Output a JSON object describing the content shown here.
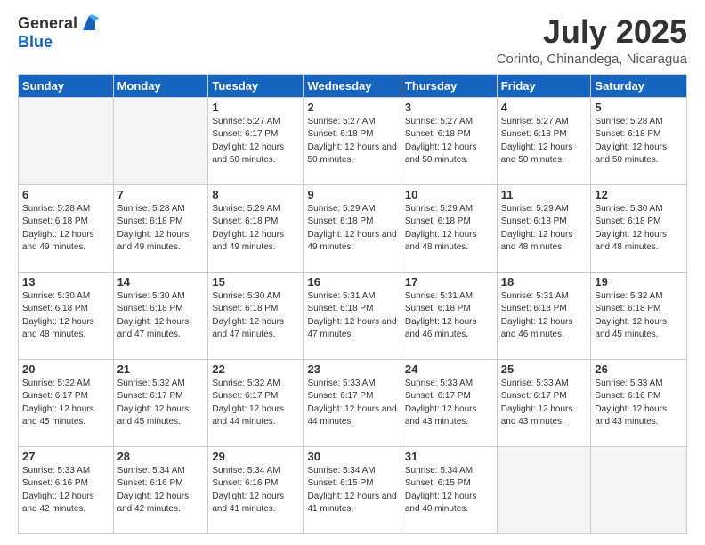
{
  "header": {
    "logo_general": "General",
    "logo_blue": "Blue",
    "month_title": "July 2025",
    "location": "Corinto, Chinandega, Nicaragua"
  },
  "days_of_week": [
    "Sunday",
    "Monday",
    "Tuesday",
    "Wednesday",
    "Thursday",
    "Friday",
    "Saturday"
  ],
  "weeks": [
    [
      {
        "day": "",
        "info": ""
      },
      {
        "day": "",
        "info": ""
      },
      {
        "day": "1",
        "info": "Sunrise: 5:27 AM\nSunset: 6:17 PM\nDaylight: 12 hours and 50 minutes."
      },
      {
        "day": "2",
        "info": "Sunrise: 5:27 AM\nSunset: 6:18 PM\nDaylight: 12 hours and 50 minutes."
      },
      {
        "day": "3",
        "info": "Sunrise: 5:27 AM\nSunset: 6:18 PM\nDaylight: 12 hours and 50 minutes."
      },
      {
        "day": "4",
        "info": "Sunrise: 5:27 AM\nSunset: 6:18 PM\nDaylight: 12 hours and 50 minutes."
      },
      {
        "day": "5",
        "info": "Sunrise: 5:28 AM\nSunset: 6:18 PM\nDaylight: 12 hours and 50 minutes."
      }
    ],
    [
      {
        "day": "6",
        "info": "Sunrise: 5:28 AM\nSunset: 6:18 PM\nDaylight: 12 hours and 49 minutes."
      },
      {
        "day": "7",
        "info": "Sunrise: 5:28 AM\nSunset: 6:18 PM\nDaylight: 12 hours and 49 minutes."
      },
      {
        "day": "8",
        "info": "Sunrise: 5:29 AM\nSunset: 6:18 PM\nDaylight: 12 hours and 49 minutes."
      },
      {
        "day": "9",
        "info": "Sunrise: 5:29 AM\nSunset: 6:18 PM\nDaylight: 12 hours and 49 minutes."
      },
      {
        "day": "10",
        "info": "Sunrise: 5:29 AM\nSunset: 6:18 PM\nDaylight: 12 hours and 48 minutes."
      },
      {
        "day": "11",
        "info": "Sunrise: 5:29 AM\nSunset: 6:18 PM\nDaylight: 12 hours and 48 minutes."
      },
      {
        "day": "12",
        "info": "Sunrise: 5:30 AM\nSunset: 6:18 PM\nDaylight: 12 hours and 48 minutes."
      }
    ],
    [
      {
        "day": "13",
        "info": "Sunrise: 5:30 AM\nSunset: 6:18 PM\nDaylight: 12 hours and 48 minutes."
      },
      {
        "day": "14",
        "info": "Sunrise: 5:30 AM\nSunset: 6:18 PM\nDaylight: 12 hours and 47 minutes."
      },
      {
        "day": "15",
        "info": "Sunrise: 5:30 AM\nSunset: 6:18 PM\nDaylight: 12 hours and 47 minutes."
      },
      {
        "day": "16",
        "info": "Sunrise: 5:31 AM\nSunset: 6:18 PM\nDaylight: 12 hours and 47 minutes."
      },
      {
        "day": "17",
        "info": "Sunrise: 5:31 AM\nSunset: 6:18 PM\nDaylight: 12 hours and 46 minutes."
      },
      {
        "day": "18",
        "info": "Sunrise: 5:31 AM\nSunset: 6:18 PM\nDaylight: 12 hours and 46 minutes."
      },
      {
        "day": "19",
        "info": "Sunrise: 5:32 AM\nSunset: 6:18 PM\nDaylight: 12 hours and 45 minutes."
      }
    ],
    [
      {
        "day": "20",
        "info": "Sunrise: 5:32 AM\nSunset: 6:17 PM\nDaylight: 12 hours and 45 minutes."
      },
      {
        "day": "21",
        "info": "Sunrise: 5:32 AM\nSunset: 6:17 PM\nDaylight: 12 hours and 45 minutes."
      },
      {
        "day": "22",
        "info": "Sunrise: 5:32 AM\nSunset: 6:17 PM\nDaylight: 12 hours and 44 minutes."
      },
      {
        "day": "23",
        "info": "Sunrise: 5:33 AM\nSunset: 6:17 PM\nDaylight: 12 hours and 44 minutes."
      },
      {
        "day": "24",
        "info": "Sunrise: 5:33 AM\nSunset: 6:17 PM\nDaylight: 12 hours and 43 minutes."
      },
      {
        "day": "25",
        "info": "Sunrise: 5:33 AM\nSunset: 6:17 PM\nDaylight: 12 hours and 43 minutes."
      },
      {
        "day": "26",
        "info": "Sunrise: 5:33 AM\nSunset: 6:16 PM\nDaylight: 12 hours and 43 minutes."
      }
    ],
    [
      {
        "day": "27",
        "info": "Sunrise: 5:33 AM\nSunset: 6:16 PM\nDaylight: 12 hours and 42 minutes."
      },
      {
        "day": "28",
        "info": "Sunrise: 5:34 AM\nSunset: 6:16 PM\nDaylight: 12 hours and 42 minutes."
      },
      {
        "day": "29",
        "info": "Sunrise: 5:34 AM\nSunset: 6:16 PM\nDaylight: 12 hours and 41 minutes."
      },
      {
        "day": "30",
        "info": "Sunrise: 5:34 AM\nSunset: 6:15 PM\nDaylight: 12 hours and 41 minutes."
      },
      {
        "day": "31",
        "info": "Sunrise: 5:34 AM\nSunset: 6:15 PM\nDaylight: 12 hours and 40 minutes."
      },
      {
        "day": "",
        "info": ""
      },
      {
        "day": "",
        "info": ""
      }
    ]
  ]
}
